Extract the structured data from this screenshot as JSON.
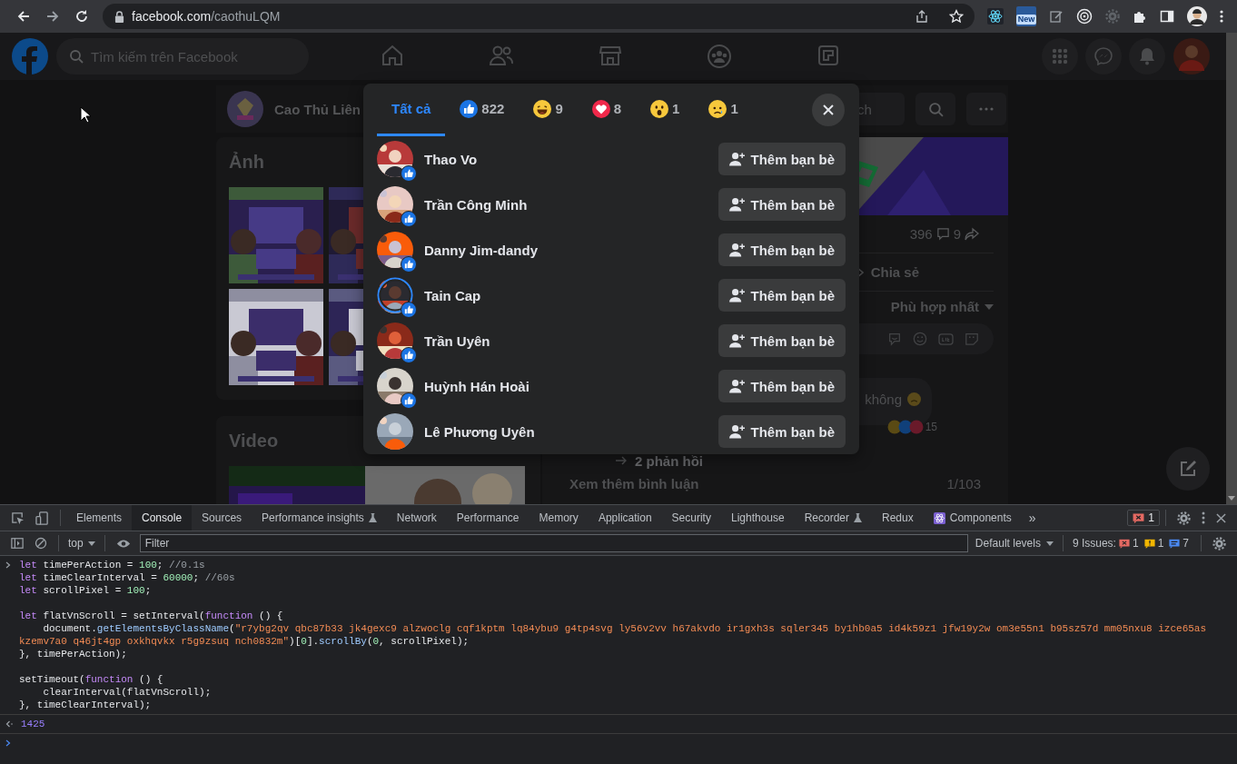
{
  "browser": {
    "url_host": "facebook.com",
    "url_path": "/caothuLQM",
    "extension_badge": "New"
  },
  "facebook": {
    "search_placeholder": "Tìm kiếm trên Facebook",
    "page_name": "Cao Thủ Liên",
    "page_search": "ch",
    "photos_title": "Ảnh",
    "video_title": "Video",
    "post": {
      "comment_count": "396",
      "share_count": "9",
      "share_label": "Chia sẻ",
      "sort_label": "Phù hợp nhất",
      "comment_text": "không",
      "comment_reactions": "15",
      "replies": "2 phản hồi",
      "more_comments": "Xem thêm bình luận",
      "pager": "1/103"
    }
  },
  "reactions_dialog": {
    "tabs": [
      {
        "kind": "all",
        "label": "Tất cả",
        "selected": true
      },
      {
        "kind": "like",
        "label": "822",
        "selected": false
      },
      {
        "kind": "haha",
        "label": "9",
        "selected": false
      },
      {
        "kind": "love",
        "label": "8",
        "selected": false
      },
      {
        "kind": "wow",
        "label": "1",
        "selected": false
      },
      {
        "kind": "sad",
        "label": "1",
        "selected": false
      }
    ],
    "people": [
      {
        "name": "Thao Vo",
        "reaction": {
          "kind": "like"
        },
        "story_ring": false,
        "action": "Thêm bạn bè"
      },
      {
        "name": "Trần Công Minh",
        "reaction": {
          "kind": "like"
        },
        "story_ring": false,
        "action": "Thêm bạn bè"
      },
      {
        "name": "Danny Jim-dandy",
        "reaction": {
          "kind": "like"
        },
        "story_ring": false,
        "action": "Thêm bạn bè"
      },
      {
        "name": "Tain Cap",
        "reaction": {
          "kind": "like"
        },
        "story_ring": true,
        "action": "Thêm bạn bè"
      },
      {
        "name": "Trần Uyên",
        "reaction": {
          "kind": "like"
        },
        "story_ring": false,
        "action": "Thêm bạn bè"
      },
      {
        "name": "Huỳnh Hán Hoài",
        "reaction": {
          "kind": "like"
        },
        "story_ring": false,
        "action": "Thêm bạn bè"
      },
      {
        "name": "Lê Phương Uyên",
        "story_ring": false,
        "action": "Thêm bạn bè"
      }
    ]
  },
  "devtools": {
    "tabs": [
      {
        "label": "Elements",
        "kind": "plain",
        "selected": false
      },
      {
        "label": "Console",
        "kind": "plain",
        "selected": true
      },
      {
        "label": "Sources",
        "kind": "plain",
        "selected": false
      },
      {
        "label": "Performance insights",
        "kind": "experimental",
        "selected": false
      },
      {
        "label": "Network",
        "kind": "plain",
        "selected": false
      },
      {
        "label": "Performance",
        "kind": "plain",
        "selected": false
      },
      {
        "label": "Memory",
        "kind": "plain",
        "selected": false
      },
      {
        "label": "Application",
        "kind": "plain",
        "selected": false
      },
      {
        "label": "Security",
        "kind": "plain",
        "selected": false
      },
      {
        "label": "Lighthouse",
        "kind": "plain",
        "selected": false
      },
      {
        "label": "Recorder",
        "kind": "experimental",
        "selected": false
      },
      {
        "label": "Redux",
        "kind": "plain",
        "selected": false
      },
      {
        "label": "Components",
        "kind": "react",
        "selected": false
      }
    ],
    "more_tabs": "»",
    "error_count": "1",
    "context": "top",
    "filter_placeholder": "Filter",
    "levels": "Default levels",
    "issues_label": "9 Issues:",
    "issue_counts": [
      {
        "kind": "error",
        "count": "1"
      },
      {
        "kind": "warning",
        "count": "1"
      },
      {
        "kind": "info",
        "count": "7"
      }
    ],
    "console": [
      {
        "kind": "input",
        "statements": [
          {
            "lines": [
              [
                {
                  "kind": "keyword",
                  "text": "let"
                },
                {
                  "kind": "plain",
                  "text": " timePerAction = "
                },
                {
                  "kind": "number",
                  "text": "100"
                },
                {
                  "kind": "plain",
                  "text": "; "
                },
                {
                  "kind": "comment",
                  "text": "//0.1s"
                }
              ],
              [
                {
                  "kind": "keyword",
                  "text": "let"
                },
                {
                  "kind": "plain",
                  "text": " timeClearInterval = "
                },
                {
                  "kind": "number",
                  "text": "60000"
                },
                {
                  "kind": "plain",
                  "text": "; "
                },
                {
                  "kind": "comment",
                  "text": "//60s"
                }
              ],
              [
                {
                  "kind": "keyword",
                  "text": "let"
                },
                {
                  "kind": "plain",
                  "text": " scrollPixel = "
                },
                {
                  "kind": "number",
                  "text": "100"
                },
                {
                  "kind": "plain",
                  "text": ";"
                }
              ]
            ]
          },
          {
            "lines": [
              [
                {
                  "kind": "keyword",
                  "text": "let"
                },
                {
                  "kind": "plain",
                  "text": " flatVnScroll = setInterval("
                },
                {
                  "kind": "keyword",
                  "text": "function"
                },
                {
                  "kind": "plain",
                  "text": " () {"
                }
              ],
              [
                {
                  "kind": "plain",
                  "text": "    document."
                },
                {
                  "kind": "method",
                  "text": "getElementsByClassName"
                },
                {
                  "kind": "plain",
                  "text": "("
                },
                {
                  "kind": "string",
                  "text": "\"r7ybg2qv qbc87b33 jk4gexc9 alzwoclg cqf1kptm lq84ybu9 g4tp4svg ly56v2vv h67akvdo ir1gxh3s sqler345 by1hb0a5 id4k59z1 jfw19y2w om3e55n1 b95sz57d mm05nxu8 izce65as"
                }
              ],
              [
                {
                  "kind": "string",
                  "text": "kzemv7a0 q46jt4gp oxkhqvkx r5g9zsuq nch0832m\""
                },
                {
                  "kind": "plain",
                  "text": ")["
                },
                {
                  "kind": "number",
                  "text": "0"
                },
                {
                  "kind": "plain",
                  "text": "]."
                },
                {
                  "kind": "method",
                  "text": "scrollBy"
                },
                {
                  "kind": "plain",
                  "text": "("
                },
                {
                  "kind": "number",
                  "text": "0"
                },
                {
                  "kind": "plain",
                  "text": ", scrollPixel);"
                }
              ],
              [
                {
                  "kind": "plain",
                  "text": "}, timePerAction);"
                }
              ]
            ]
          },
          {
            "lines": [
              [
                {
                  "kind": "plain",
                  "text": "setTimeout("
                },
                {
                  "kind": "keyword",
                  "text": "function"
                },
                {
                  "kind": "plain",
                  "text": " () {"
                }
              ],
              [
                {
                  "kind": "plain",
                  "text": "    clearInterval(flatVnScroll);"
                }
              ],
              [
                {
                  "kind": "plain",
                  "text": "}, timeClearInterval);"
                }
              ]
            ]
          }
        ]
      },
      {
        "kind": "result",
        "text": "1425"
      }
    ]
  }
}
